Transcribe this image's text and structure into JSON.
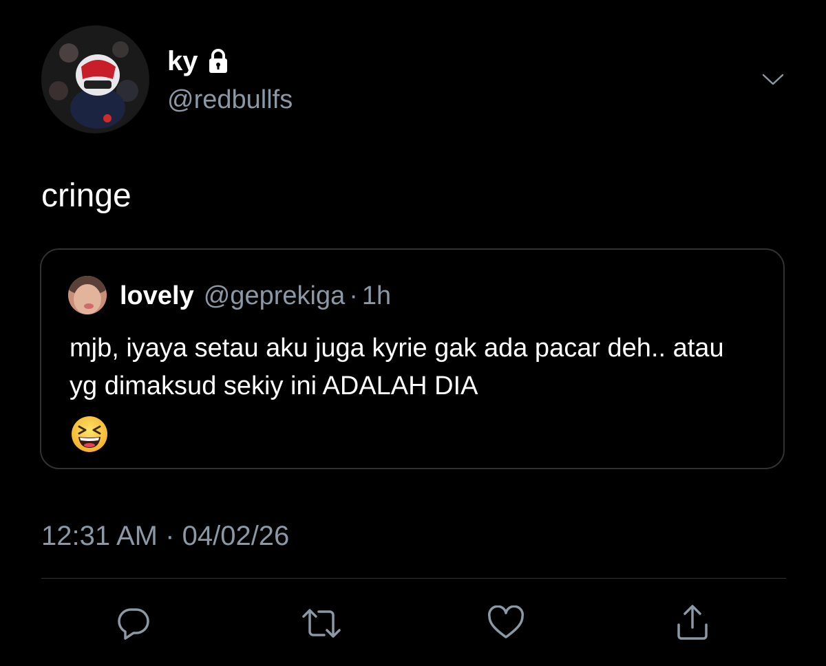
{
  "author": {
    "display_name": "ky",
    "handle": "@redbullfs",
    "protected_icon": "lock-icon"
  },
  "tweet": {
    "text": "cringe",
    "time": "12:31 AM",
    "separator": "·",
    "date": "04/02/26"
  },
  "quoted_tweet": {
    "display_name": "lovely",
    "handle": "@geprekiga",
    "separator": "·",
    "age": "1h",
    "text": "mjb, iyaya setau aku juga kyrie gak ada pacar deh.. atau yg dimaksud sekiy ini ADALAH DIA",
    "emoji_icon": "grinning-squinting-face-emoji"
  },
  "actions": [
    {
      "name": "reply",
      "icon": "reply-bubble-icon"
    },
    {
      "name": "retweet",
      "icon": "retweet-arrows-icon"
    },
    {
      "name": "like",
      "icon": "heart-icon"
    },
    {
      "name": "share",
      "icon": "share-upload-icon"
    }
  ],
  "colors": {
    "background": "#000000",
    "primary_text": "#ffffff",
    "secondary_text": "#8b98a5",
    "border": "#2f3336",
    "icon": "#8b98a5"
  }
}
